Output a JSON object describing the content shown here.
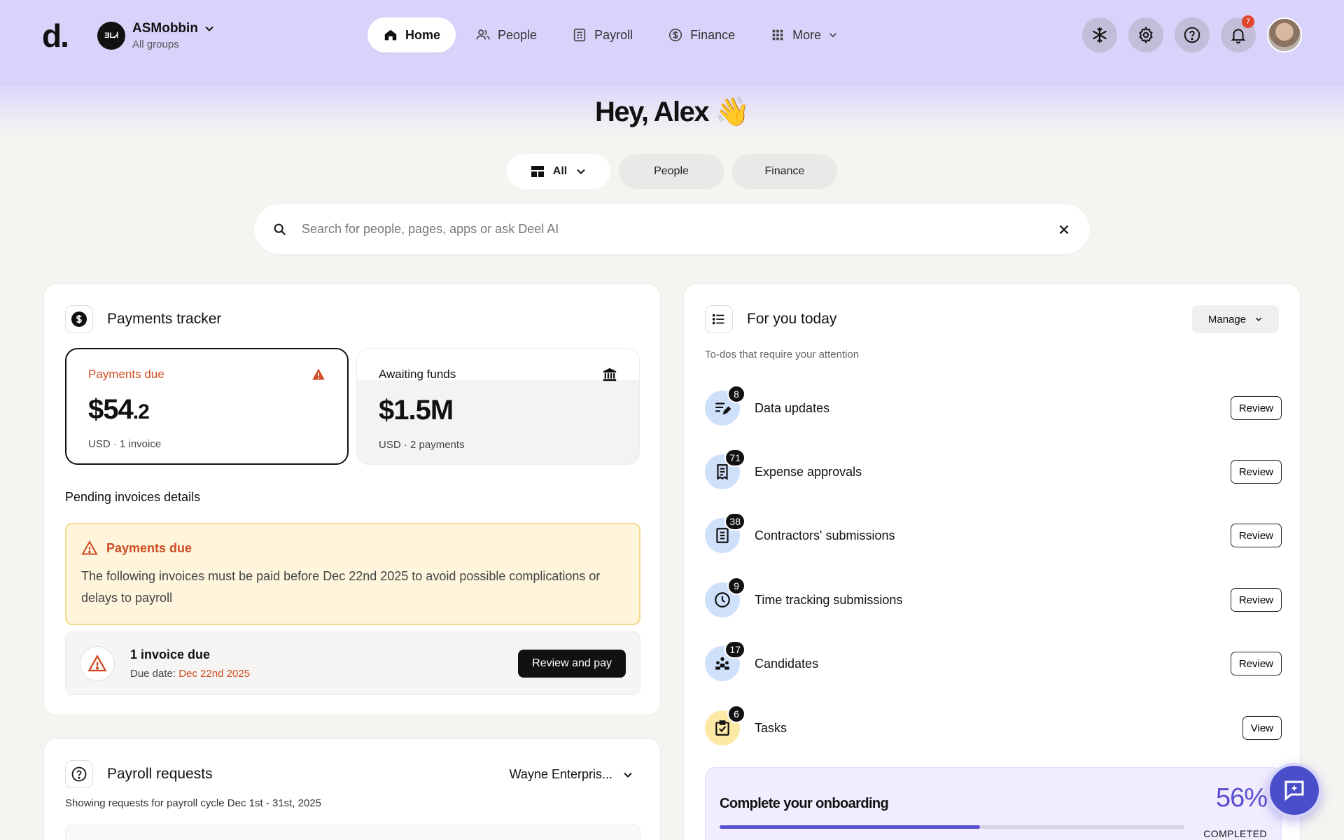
{
  "header": {
    "logo": "d.",
    "org_initials": "ƎLᏗ",
    "org_name": "ASMobbin",
    "org_sub": "All groups",
    "nav": [
      {
        "label": "Home",
        "icon": "home-icon",
        "active": true
      },
      {
        "label": "People",
        "icon": "people-icon"
      },
      {
        "label": "Payroll",
        "icon": "payroll-icon"
      },
      {
        "label": "Finance",
        "icon": "dollar-icon"
      },
      {
        "label": "More",
        "icon": "grid-icon"
      }
    ],
    "notification_count": "7"
  },
  "greeting": "Hey, Alex 👋",
  "filters": {
    "all": "All",
    "people": "People",
    "finance": "Finance"
  },
  "search": {
    "placeholder": "Search for people, pages, apps or ask Deel AI"
  },
  "payments_tracker": {
    "title": "Payments tracker",
    "due": {
      "label": "Payments due",
      "amount_main": "$54",
      "amount_dec": ".2",
      "sub": "USD · 1 invoice"
    },
    "awaiting": {
      "label": "Awaiting funds",
      "amount": "$1.5M",
      "sub": "USD · 2 payments"
    },
    "pending_title": "Pending invoices details",
    "warning": {
      "title": "Payments due",
      "text": "The following invoices must be paid before Dec 22nd 2025 to avoid possible complications or delays to payroll"
    },
    "invoice": {
      "title": "1 invoice due",
      "due_label": "Due date: ",
      "due_date": "Dec 22nd 2025",
      "button": "Review and pay"
    }
  },
  "payroll_requests": {
    "title": "Payroll requests",
    "entity": "Wayne Enterpris...",
    "sub": "Showing requests for payroll cycle Dec 1st - 31st, 2025"
  },
  "for_you": {
    "title": "For you today",
    "manage": "Manage",
    "sub": "To-dos that require your attention",
    "items": [
      {
        "label": "Data updates",
        "count": "8",
        "action": "Review",
        "icon": "edit-list-icon"
      },
      {
        "label": "Expense approvals",
        "count": "71",
        "action": "Review",
        "icon": "receipt-icon"
      },
      {
        "label": "Contractors' submissions",
        "count": "38",
        "action": "Review",
        "icon": "document-icon"
      },
      {
        "label": "Time tracking submissions",
        "count": "9",
        "action": "Review",
        "icon": "clock-icon"
      },
      {
        "label": "Candidates",
        "count": "17",
        "action": "Review",
        "icon": "group-icon"
      },
      {
        "label": "Tasks",
        "count": "6",
        "action": "View",
        "icon": "checkbox-icon"
      }
    ]
  },
  "onboarding": {
    "title": "Complete your onboarding",
    "percent": "56%",
    "progress": 0.56,
    "status": "COMPLETED"
  },
  "colors": {
    "accent": "#5a4fcf",
    "warning": "#d04c23",
    "topbar": "#d9d3fb"
  }
}
